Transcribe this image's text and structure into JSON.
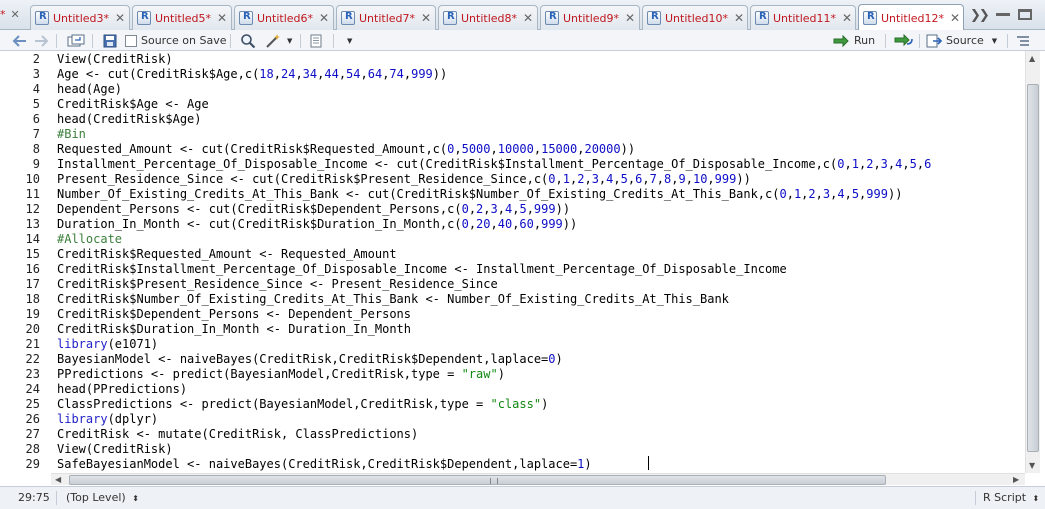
{
  "tabs": [
    {
      "label": "*",
      "partial": true
    },
    {
      "label": "Untitled3*"
    },
    {
      "label": "Untitled5*"
    },
    {
      "label": "Untitled6*"
    },
    {
      "label": "Untitled7*"
    },
    {
      "label": "Untitled8*"
    },
    {
      "label": "Untitled9*"
    },
    {
      "label": "Untitled10*"
    },
    {
      "label": "Untitled11*"
    },
    {
      "label": "Untitled12*",
      "active": true
    }
  ],
  "toolbar": {
    "source_on_save_label": "Source on Save",
    "run_label": "Run",
    "source_label": "Source"
  },
  "editor": {
    "lines": [
      {
        "n": "2",
        "text": "View(CreditRisk)"
      },
      {
        "n": "3",
        "text": "Age <- cut(CreditRisk$Age,c(18,24,34,44,54,64,74,999))"
      },
      {
        "n": "4",
        "text": "head(Age)"
      },
      {
        "n": "5",
        "text": "CreditRisk$Age <- Age"
      },
      {
        "n": "6",
        "text": "head(CreditRisk$Age)"
      },
      {
        "n": "7",
        "text": "#Bin"
      },
      {
        "n": "8",
        "text": "Requested_Amount <- cut(CreditRisk$Requested_Amount,c(0,5000,10000,15000,20000))"
      },
      {
        "n": "9",
        "text": "Installment_Percentage_Of_Disposable_Income <- cut(CreditRisk$Installment_Percentage_Of_Disposable_Income,c(0,1,2,3,4,5,6"
      },
      {
        "n": "10",
        "text": "Present_Residence_Since <- cut(CreditRisk$Present_Residence_Since,c(0,1,2,3,4,5,6,7,8,9,10,999))"
      },
      {
        "n": "11",
        "text": "Number_Of_Existing_Credits_At_This_Bank <- cut(CreditRisk$Number_Of_Existing_Credits_At_This_Bank,c(0,1,2,3,4,5,999))"
      },
      {
        "n": "12",
        "text": "Dependent_Persons <- cut(CreditRisk$Dependent_Persons,c(0,2,3,4,5,999))"
      },
      {
        "n": "13",
        "text": "Duration_In_Month <- cut(CreditRisk$Duration_In_Month,c(0,20,40,60,999))"
      },
      {
        "n": "14",
        "text": "#Allocate"
      },
      {
        "n": "15",
        "text": "CreditRisk$Requested_Amount <- Requested_Amount"
      },
      {
        "n": "16",
        "text": "CreditRisk$Installment_Percentage_Of_Disposable_Income <- Installment_Percentage_Of_Disposable_Income"
      },
      {
        "n": "17",
        "text": "CreditRisk$Present_Residence_Since <- Present_Residence_Since"
      },
      {
        "n": "18",
        "text": "CreditRisk$Number_Of_Existing_Credits_At_This_Bank <- Number_Of_Existing_Credits_At_This_Bank"
      },
      {
        "n": "19",
        "text": "CreditRisk$Dependent_Persons <- Dependent_Persons"
      },
      {
        "n": "20",
        "text": "CreditRisk$Duration_In_Month <- Duration_In_Month"
      },
      {
        "n": "21",
        "text": "library(e1071)"
      },
      {
        "n": "22",
        "text": "BayesianModel <- naiveBayes(CreditRisk,CreditRisk$Dependent,laplace=0)"
      },
      {
        "n": "23",
        "text": "PPredictions <- predict(BayesianModel,CreditRisk,type = \"raw\")"
      },
      {
        "n": "24",
        "text": "head(PPredictions)"
      },
      {
        "n": "25",
        "text": "ClassPredictions <- predict(BayesianModel,CreditRisk,type = \"class\")"
      },
      {
        "n": "26",
        "text": "library(dplyr)"
      },
      {
        "n": "27",
        "text": "CreditRisk <- mutate(CreditRisk, ClassPredictions)"
      },
      {
        "n": "28",
        "text": "View(CreditRisk)"
      },
      {
        "n": "29",
        "text": "SafeBayesianModel <- naiveBayes(CreditRisk,CreditRisk$Dependent,laplace=1)"
      }
    ]
  },
  "statusbar": {
    "position": "29:75",
    "scope": "(Top Level)",
    "filetype": "R Script"
  },
  "colors": {
    "tab_text": "#c0181f",
    "comment": "#3c803c",
    "keyword": "#2323c8",
    "string": "#118811"
  }
}
